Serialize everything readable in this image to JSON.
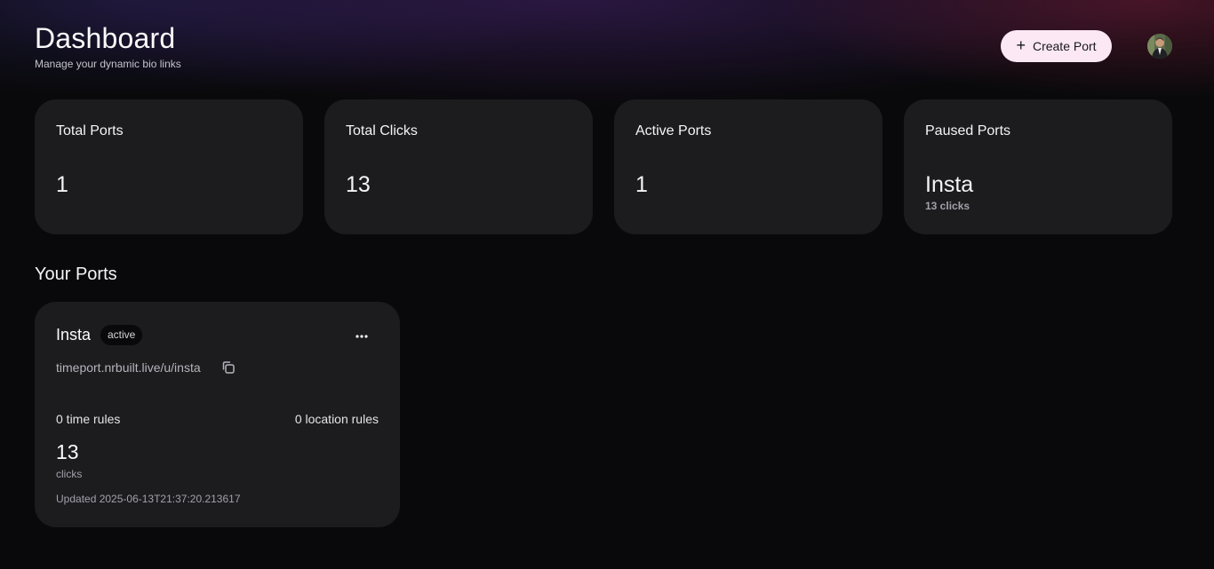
{
  "header": {
    "title": "Dashboard",
    "subtitle": "Manage your dynamic bio links",
    "create_label": "Create Port",
    "create_icon": "plus-icon",
    "avatar_icon": "user-avatar"
  },
  "stats": [
    {
      "label": "Total Ports",
      "value": "1"
    },
    {
      "label": "Total Clicks",
      "value": "13"
    },
    {
      "label": "Active Ports",
      "value": "1"
    },
    {
      "label": "Paused Ports",
      "value": "Insta",
      "sub": "13 clicks"
    }
  ],
  "ports_section": {
    "title": "Your Ports",
    "ports": [
      {
        "name": "Insta",
        "status": "active",
        "url": "timeport.nrbuilt.live/u/insta",
        "time_rules": "0 time rules",
        "location_rules": "0 location rules",
        "clicks": "13",
        "clicks_label": "clicks",
        "updated": "Updated 2025-06-13T21:37:20.213617"
      }
    ]
  },
  "colors": {
    "background": "#09090b",
    "card": "#1c1c1f",
    "button": "#fbe8f4"
  }
}
